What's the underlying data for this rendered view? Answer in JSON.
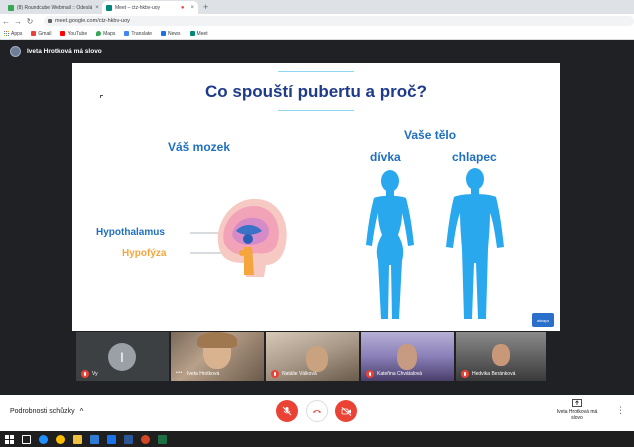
{
  "browser": {
    "tabs": [
      {
        "title": "(8) Roundcube Webmail :: Odeslá",
        "color": "#34a853",
        "active": false
      },
      {
        "title": "Meet – ctz-hkbv-uoy",
        "color": "#00897b",
        "active": true
      }
    ],
    "address": "meet.google.com/ctz-hkbv-uoy",
    "bookmarks": [
      {
        "label": "Apps",
        "color": "#4285f4"
      },
      {
        "label": "Gmail",
        "color": "#ea4335"
      },
      {
        "label": "YouTube",
        "color": "#ff0000"
      },
      {
        "label": "Maps",
        "color": "#34a853"
      },
      {
        "label": "Translate",
        "color": "#4285f4"
      },
      {
        "label": "News",
        "color": "#1a73e8"
      },
      {
        "label": "Meet",
        "color": "#00897b"
      }
    ]
  },
  "meeting": {
    "presenter_banner": "Iveta Hrotková má slovo"
  },
  "slide": {
    "title": "Co spouští pubertu a proč?",
    "brain_heading": "Váš mozek",
    "body_heading": "Vaše tělo",
    "girl_label": "dívka",
    "boy_label": "chlapec",
    "hypothalamus": "Hypothalamus",
    "hypofyza": "Hypofýza",
    "brand": "always"
  },
  "participants": [
    {
      "name": "Vy",
      "avatar_letter": "I",
      "muted": true
    },
    {
      "name": "Iveta Hrotková",
      "muted": false,
      "speaking_indicator": "•••"
    },
    {
      "name": "Natálie Válková",
      "muted": true
    },
    {
      "name": "Kateřina Chvátalová",
      "muted": true
    },
    {
      "name": "Hedvika Beránková",
      "muted": true
    }
  ],
  "controls": {
    "details_label": "Podrobnosti schůzky",
    "present_label": "Iveta Hrotková má slovo"
  },
  "colors": {
    "accent_red": "#ea4335",
    "slide_blue": "#1d6fc0",
    "slide_title": "#1e3a8a",
    "body_blue": "#29a8ee",
    "orange": "#f4a63c"
  }
}
